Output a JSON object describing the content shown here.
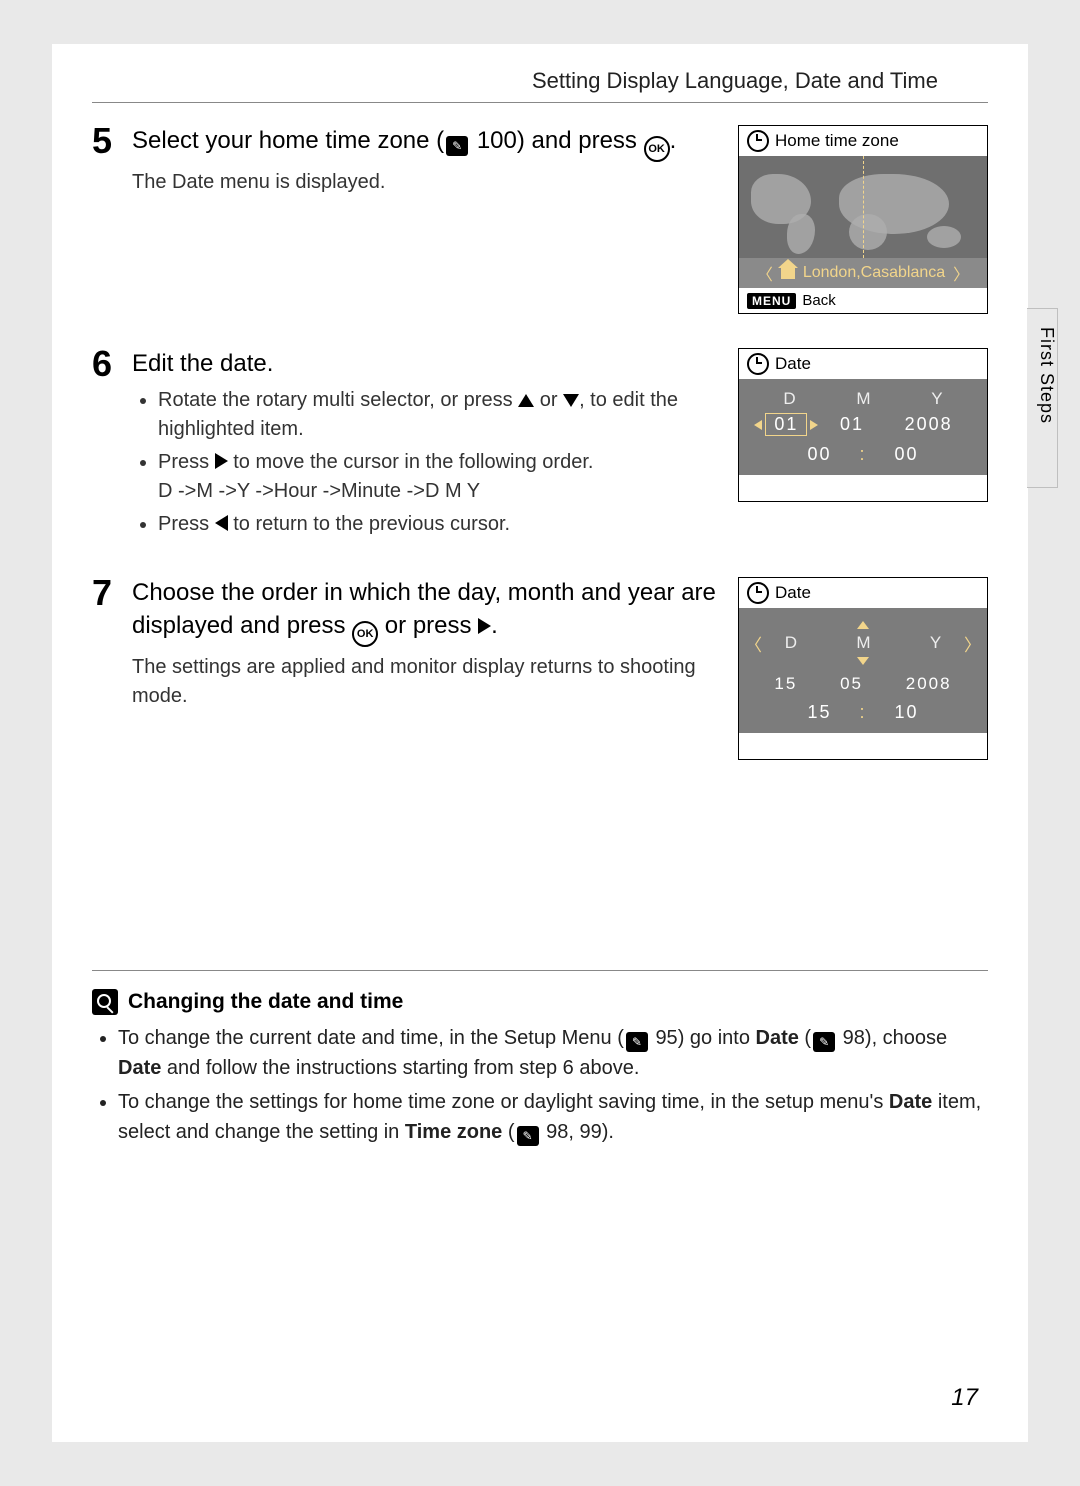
{
  "header": "Setting Display Language, Date and Time",
  "side_tab": "First Steps",
  "page_number": "17",
  "steps": {
    "s5": {
      "num": "5",
      "title_a": "Select your home time zone (",
      "title_ref": "100",
      "title_b": ") and press ",
      "desc": "The Date menu is displayed."
    },
    "s6": {
      "num": "6",
      "title": "Edit the date.",
      "b1a": "Rotate the rotary multi selector, or press ",
      "b1b": " or ",
      "b1c": ", to edit the highlighted item.",
      "b2a": "Press ",
      "b2b": " to move the cursor in the following order.",
      "b2c": "D ->M ->Y ->Hour ->Minute ->D M Y",
      "b3a": "Press ",
      "b3b": " to return to the previous cursor."
    },
    "s7": {
      "num": "7",
      "title_a": "Choose the order in which the day, month and year are displayed and press ",
      "title_b": " or press ",
      "title_c": ".",
      "desc": "The settings are applied and monitor display returns to shooting mode."
    }
  },
  "screens": {
    "tz": {
      "title": "Home time zone",
      "city": "London,Casablanca",
      "back": "Back"
    },
    "date1": {
      "title": "Date",
      "d": "D",
      "m": "M",
      "y": "Y",
      "dv": "01",
      "mv": "01",
      "yv": "2008",
      "hh": "00",
      "mm": "00"
    },
    "date2": {
      "title": "Date",
      "d": "D",
      "m": "M",
      "y": "Y",
      "dv": "15",
      "mv": "05",
      "yv": "2008",
      "hh": "15",
      "mm": "10"
    }
  },
  "note": {
    "title": "Changing the date and time",
    "b1a": "To change the current date and time, in the Setup Menu (",
    "b1ref1": "95",
    "b1b": ") go into ",
    "b1bold1": "Date",
    "b1c": " (",
    "b1ref2": "98",
    "b1d": "), choose ",
    "b1bold2": "Date",
    "b1e": " and follow the instructions starting from step 6 above.",
    "b2a": "To change the settings for home time zone or daylight saving time, in the setup menu's ",
    "b2bold1": "Date",
    "b2b": " item, select and change the setting in ",
    "b2bold2": "Time zone",
    "b2c": " (",
    "b2ref": "98, 99",
    "b2d": ")."
  }
}
